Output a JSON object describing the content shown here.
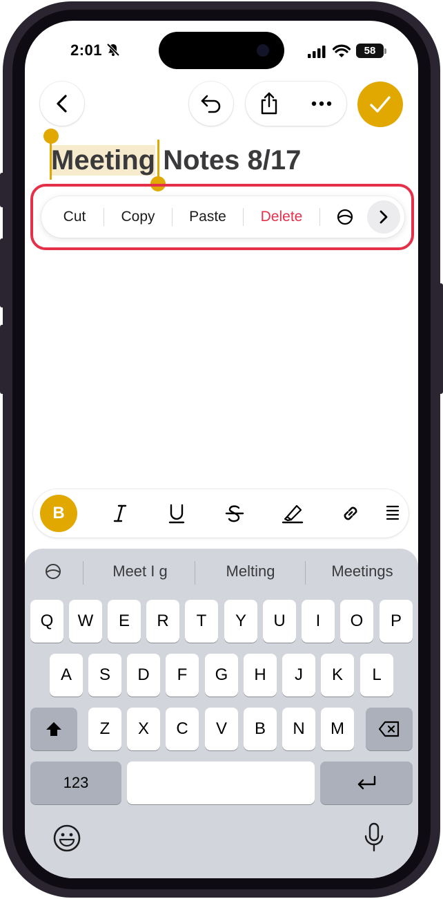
{
  "status_bar": {
    "time": "2:01",
    "battery": "58"
  },
  "toolbar": {
    "back_icon": "chevron-left-icon",
    "undo_icon": "undo-icon",
    "share_icon": "share-icon",
    "more_icon": "ellipsis-icon",
    "done_icon": "checkmark-icon",
    "accent_color": "#e0a800"
  },
  "note": {
    "title_selected": "Meeting",
    "title_rest": " Notes 8/17"
  },
  "edit_menu": {
    "items": [
      "Cut",
      "Copy",
      "Paste",
      "Delete"
    ],
    "delete_color": "#e5304a",
    "ai_icon": "writing-tools-icon",
    "more_icon": "chevron-right-icon"
  },
  "format_bar": {
    "bold_label": "B",
    "buttons": [
      "italic-icon",
      "underline-icon",
      "strikethrough-icon",
      "highlighter-icon",
      "link-icon",
      "list-icon"
    ]
  },
  "keyboard": {
    "suggestions": [
      "Meet I g",
      "Melting",
      "Meetings"
    ],
    "row1": [
      "Q",
      "W",
      "E",
      "R",
      "T",
      "Y",
      "U",
      "I",
      "O",
      "P"
    ],
    "row2": [
      "A",
      "S",
      "D",
      "F",
      "G",
      "H",
      "J",
      "K",
      "L"
    ],
    "row3": [
      "Z",
      "X",
      "C",
      "V",
      "B",
      "N",
      "M"
    ],
    "numbers_label": "123"
  }
}
